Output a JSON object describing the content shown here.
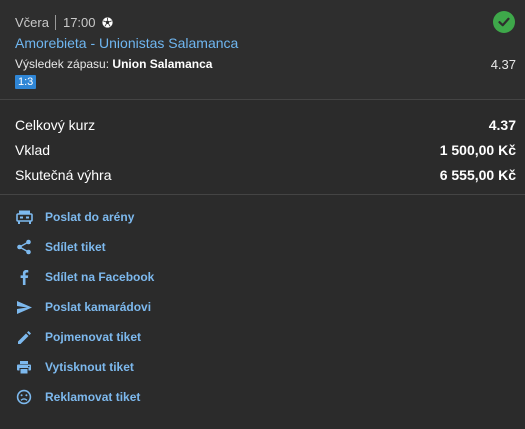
{
  "ticket": {
    "date_label": "Včera",
    "time": "17:00",
    "sport_icon": "soccer-ball-icon",
    "status_icon": "check-circle-icon",
    "status_color": "#3ea84a",
    "match": "Amorebieta - Unionistas Salamanca",
    "market_label": "Výsledek zápasu:",
    "selection": "Union Salamanca",
    "odd": "4.37",
    "score": "1:3"
  },
  "summary": [
    {
      "label": "Celkový kurz",
      "value": "4.37"
    },
    {
      "label": "Vklad",
      "value": "1 500,00 Kč"
    },
    {
      "label": "Skutečná výhra",
      "value": "6 555,00 Kč"
    }
  ],
  "actions": [
    {
      "label": "Poslat do arény",
      "icon": "arena-icon"
    },
    {
      "label": "Sdílet tiket",
      "icon": "share-icon"
    },
    {
      "label": "Sdílet na Facebook",
      "icon": "facebook-icon"
    },
    {
      "label": "Poslat kamarádovi",
      "icon": "send-icon"
    },
    {
      "label": "Pojmenovat tiket",
      "icon": "pencil-icon"
    },
    {
      "label": "Vytisknout tiket",
      "icon": "printer-icon"
    },
    {
      "label": "Reklamovat tiket",
      "icon": "sad-face-icon"
    }
  ],
  "colors": {
    "accent_link": "#6fb6f0",
    "score_badge": "#2f86d6",
    "background": "#2b2b2b"
  }
}
